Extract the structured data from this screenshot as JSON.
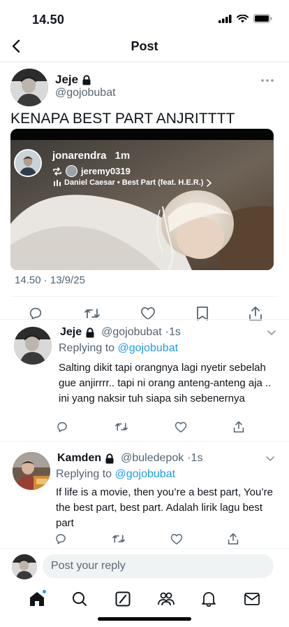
{
  "status_bar": {
    "time": "14.50"
  },
  "nav": {
    "title": "Post"
  },
  "main_tweet": {
    "author_name": "Jeje",
    "author_handle": "@gojobubat",
    "text": "KENAPA BEST PART ANJRITTTT",
    "timestamp": "14.50 · 13/9/25",
    "media": {
      "story_user": "jonarendra",
      "story_time": "1m",
      "reposted_from": "jeremy0319",
      "music": "Daniel Caesar • Best Part (feat. H.E.R.)"
    }
  },
  "replies": [
    {
      "name": "Jeje",
      "handle": "@gojobubat",
      "time": "·1s",
      "replying_prefix": "Replying to",
      "replying_to": "@gojobubat",
      "text": "Salting dikit tapi orangnya lagi nyetir sebelah gue anjirrrr.. tapi ni orang anteng-anteng aja .. ini yang naksir tuh siapa sih sebenernya",
      "locked": true
    },
    {
      "name": "Kamden",
      "handle": "@buledepok",
      "time": "·1s",
      "replying_prefix": "Replying to",
      "replying_to": "@gojobubat",
      "text": "If life is a movie, then you’re a best part, You’re the best part, best part. Adalah lirik lagu best part",
      "locked": true
    }
  ],
  "composer": {
    "placeholder": "Post your reply"
  },
  "tabs": [
    "home-icon",
    "search-icon",
    "grok-icon",
    "communities-icon",
    "notifications-icon",
    "messages-icon"
  ],
  "colors": {
    "accent": "#1d9bf0",
    "text": "#0f1419",
    "muted": "#536471"
  }
}
